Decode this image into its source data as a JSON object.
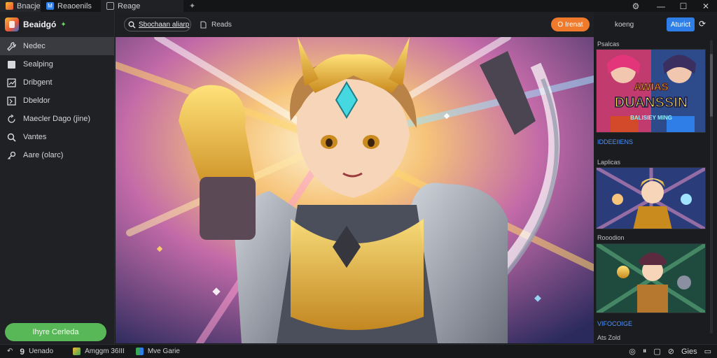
{
  "titlebar": {
    "tabs": [
      {
        "label": "Bnacje",
        "icon": "app-icon"
      },
      {
        "label": "Reaoenils",
        "icon": "m-icon"
      },
      {
        "label": "Reage",
        "icon": "image-icon"
      }
    ],
    "controls": {
      "settings": "⚙",
      "minimize": "—",
      "maximize": "☐",
      "close": "✕"
    }
  },
  "sidebar": {
    "brand": {
      "name": "Beaidgó"
    },
    "items": [
      {
        "label": "Nedec",
        "icon": "wrench-icon",
        "active": true
      },
      {
        "label": "Sealping",
        "icon": "square-icon"
      },
      {
        "label": "Dribgent",
        "icon": "chart-icon"
      },
      {
        "label": "Dbeldor",
        "icon": "screen-icon"
      },
      {
        "label": "Maecler Dago (jine)",
        "icon": "refresh-icon"
      },
      {
        "label": "Vantes",
        "icon": "search-icon"
      },
      {
        "label": "Aare (olarc)",
        "icon": "key-icon"
      }
    ],
    "cta_label": "Ihyre Cerleda"
  },
  "toolbar": {
    "search_label": "Sbochaan aliarp",
    "link_label": "Reads",
    "orange_button": "O Irenat"
  },
  "right_panel": {
    "top_label": "koeng",
    "blue_button": "Aturict",
    "sections": [
      {
        "label": "Psalcas",
        "title_blue": "IDDEEIIENS"
      },
      {
        "label": "Laplicas"
      },
      {
        "label": "Rooodion",
        "title_blue": "VIFOCOIGE"
      }
    ],
    "thumb1_text": {
      "line1": "AWIAS",
      "line2": "DUANSSIN",
      "line3": "BALISIEY MING"
    },
    "footer_label": "Ats Zold"
  },
  "statusbar": {
    "left_items": [
      {
        "label": "Uenado",
        "icon": "nine-icon"
      },
      {
        "label": "Amggm 36III",
        "icon": "game-icon"
      },
      {
        "label": "Mve Garie",
        "icon": "grid-icon"
      }
    ],
    "right_label": "Gies"
  },
  "colors": {
    "accent_green": "#58b757",
    "accent_orange": "#f07a2c",
    "accent_blue": "#2f7ee8"
  }
}
